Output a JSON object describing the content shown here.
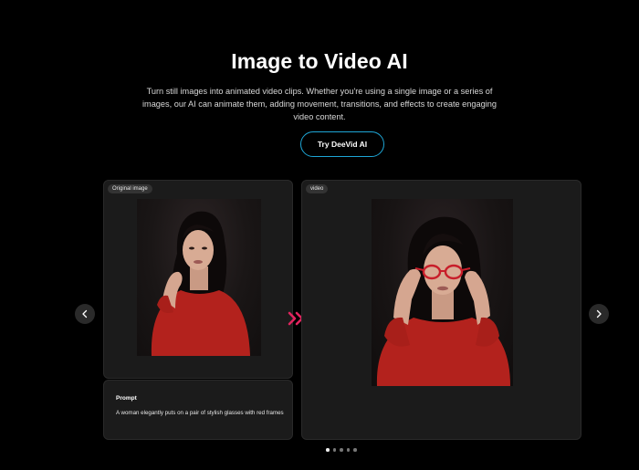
{
  "hero": {
    "title": "Image to Video AI",
    "subtitle": "Turn still images into animated video clips. Whether you're using a single image or a series of images, our AI can animate them, adding movement, transitions, and effects to create engaging video content.",
    "cta_label": "Try DeeVid AI"
  },
  "showcase": {
    "original_tag": "Original image",
    "video_tag": "video",
    "prompt_heading": "Prompt",
    "prompt_text": "A woman elegantly puts on a pair of stylish glasses with red frames"
  },
  "carousel": {
    "dot_count": 5,
    "active_index": 0
  },
  "icons": {
    "prev": "chevron-left-icon",
    "next": "chevron-right-icon",
    "transform": "double-chevron-right-icon"
  },
  "colors": {
    "accent_border": "#1ea6d6",
    "transform_arrow": "#e0245e",
    "panel_bg": "#1b1b1b"
  }
}
